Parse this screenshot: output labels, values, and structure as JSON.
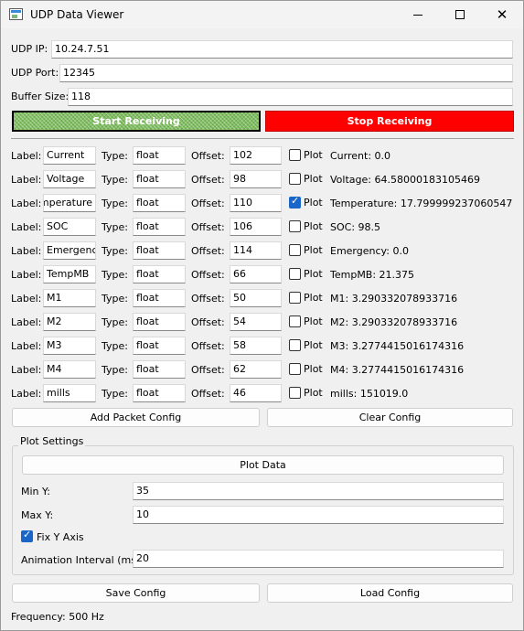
{
  "window": {
    "title": "UDP Data Viewer"
  },
  "connection": {
    "ip_label": "UDP IP:",
    "ip_value": "10.24.7.51",
    "port_label": "UDP Port:",
    "port_value": "12345",
    "buffer_label": "Buffer Size:",
    "buffer_value": "118"
  },
  "controls": {
    "start_label": "Start Receiving",
    "stop_label": "Stop Receiving"
  },
  "row_labels": {
    "label": "Label:",
    "type": "Type:",
    "offset": "Offset:",
    "plot": "Plot"
  },
  "packets": [
    {
      "label": "Current",
      "type": "float",
      "offset": "102",
      "plot": false,
      "readout": "Current: 0.0"
    },
    {
      "label": "Voltage",
      "type": "float",
      "offset": "98",
      "plot": false,
      "readout": "Voltage: 64.58000183105469"
    },
    {
      "label": "Temperature",
      "type": "float",
      "offset": "110",
      "plot": true,
      "readout": "Temperature: 17.799999237060547"
    },
    {
      "label": "SOC",
      "type": "float",
      "offset": "106",
      "plot": false,
      "readout": "SOC: 98.5"
    },
    {
      "label": "Emergency",
      "type": "float",
      "offset": "114",
      "plot": false,
      "readout": "Emergency: 0.0"
    },
    {
      "label": "TempMB",
      "type": "float",
      "offset": "66",
      "plot": false,
      "readout": "TempMB: 21.375"
    },
    {
      "label": "M1",
      "type": "float",
      "offset": "50",
      "plot": false,
      "readout": "M1: 3.290332078933716"
    },
    {
      "label": "M2",
      "type": "float",
      "offset": "54",
      "plot": false,
      "readout": "M2: 3.290332078933716"
    },
    {
      "label": "M3",
      "type": "float",
      "offset": "58",
      "plot": false,
      "readout": "M3: 3.2774415016174316"
    },
    {
      "label": "M4",
      "type": "float",
      "offset": "62",
      "plot": false,
      "readout": "M4: 3.2774415016174316"
    },
    {
      "label": "mills",
      "type": "float",
      "offset": "46",
      "plot": false,
      "readout": "mills: 151019.0"
    }
  ],
  "packet_buttons": {
    "add_label": "Add Packet Config",
    "clear_label": "Clear Config"
  },
  "plot_settings": {
    "title": "Plot Settings",
    "plot_data_label": "Plot Data",
    "min_y_label": "Min Y:",
    "min_y_value": "35",
    "max_y_label": "Max Y:",
    "max_y_value": "10",
    "fix_y_label": "Fix Y Axis",
    "fix_y_checked": true,
    "interval_label": "Animation Interval (ms):",
    "interval_value": "20"
  },
  "config_buttons": {
    "save_label": "Save Config",
    "load_label": "Load Config"
  },
  "status": {
    "frequency": "Frequency: 500 Hz"
  },
  "colors": {
    "stop": "#ff0000",
    "start": "#7fbf5f",
    "check": "#1a66c8"
  },
  "icons": {
    "app": "window-app-icon",
    "minimize": "minimize-icon",
    "maximize": "maximize-icon",
    "close": "close-icon"
  }
}
